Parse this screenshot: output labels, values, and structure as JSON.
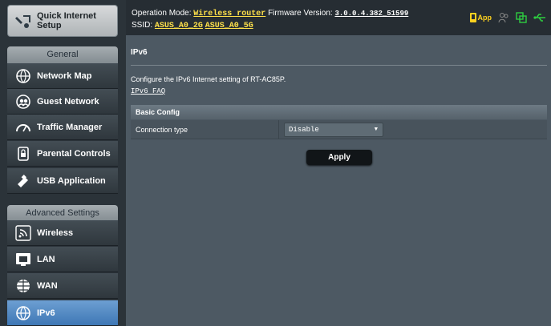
{
  "sidebar": {
    "quick_internet_setup": "Quick Internet Setup",
    "general_label": "General",
    "general_items": [
      {
        "label": "Network Map",
        "icon": "network-map-icon"
      },
      {
        "label": "Guest Network",
        "icon": "guest-network-icon"
      },
      {
        "label": "Traffic Manager",
        "icon": "traffic-manager-icon"
      },
      {
        "label": "Parental Controls",
        "icon": "parental-controls-icon"
      },
      {
        "label": "USB Application",
        "icon": "usb-application-icon"
      }
    ],
    "advanced_label": "Advanced Settings",
    "advanced_items": [
      {
        "label": "Wireless",
        "icon": "wireless-icon"
      },
      {
        "label": "LAN",
        "icon": "lan-icon"
      },
      {
        "label": "WAN",
        "icon": "wan-icon"
      },
      {
        "label": "IPv6",
        "icon": "ipv6-icon",
        "active": true
      }
    ]
  },
  "topbar": {
    "operation_mode_label": "Operation Mode:",
    "operation_mode_value": "Wireless router",
    "firmware_label": "Firmware Version:",
    "firmware_value": "3.0.0.4.382_51599",
    "ssid_label": "SSID:",
    "ssid_2g": "ASUS_A0_2G",
    "ssid_5g": "ASUS_A0_5G",
    "app_label": "App",
    "accent_color": "#ffe14a"
  },
  "main": {
    "title": "IPv6",
    "description": "Configure the IPv6 Internet setting of RT-AC85P.",
    "faq_link": "IPv6 FAQ",
    "section_title": "Basic Config",
    "connection_type_label": "Connection type",
    "connection_type_value": "Disable",
    "apply_label": "Apply"
  }
}
